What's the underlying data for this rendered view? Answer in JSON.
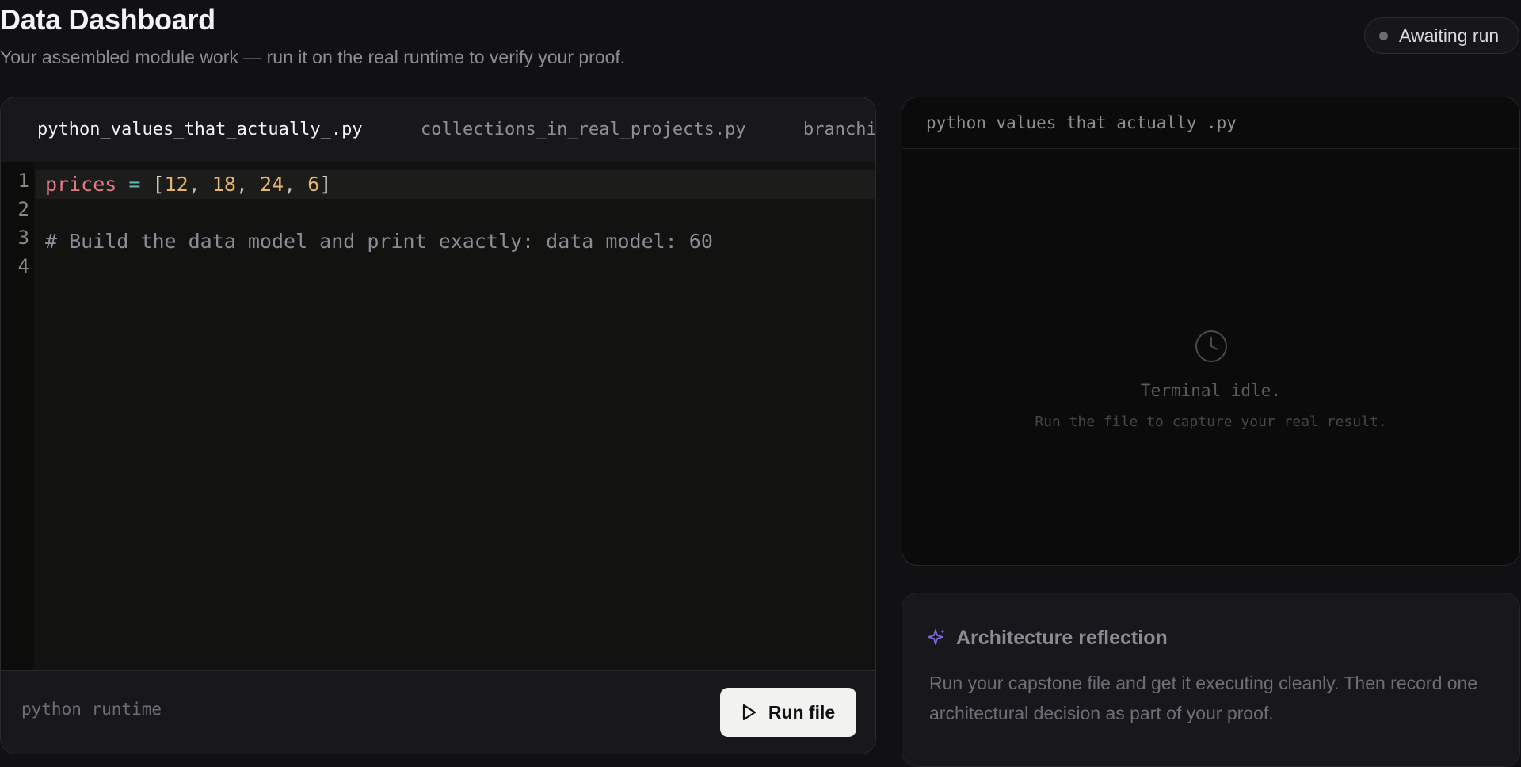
{
  "header": {
    "title": "Data Dashboard",
    "subtitle": "Your assembled module work — run it on the real runtime to verify your proof.",
    "status": "Awaiting run"
  },
  "editor": {
    "tabs": [
      {
        "label": "python_values_that_actually_.py",
        "active": true
      },
      {
        "label": "collections_in_real_projects.py",
        "active": false
      },
      {
        "label": "branchi",
        "active": false
      }
    ],
    "line_numbers": [
      "1",
      "2",
      "3",
      "4"
    ],
    "code": {
      "line1": {
        "var": "prices",
        "op": "=",
        "open": "[",
        "n1": "12",
        "n2": "18",
        "n3": "24",
        "n4": "6",
        "sep": ",",
        "close": "]"
      },
      "line3": "# Build the data model and print exactly: data model: 60"
    },
    "runtime_label": "python runtime",
    "run_button": "Run file"
  },
  "terminal": {
    "file_name": "python_values_that_actually_.py",
    "idle_text": "Terminal idle.",
    "hint_text": "Run the file to capture your real result.",
    "icon": "clock-icon"
  },
  "reflection": {
    "icon": "sparkle-icon",
    "title": "Architecture reflection",
    "body": "Run your capstone file and get it executing cleanly. Then record one architectural decision as part of your proof."
  },
  "colors": {
    "background": "#111114",
    "panel": "#18181c",
    "accent_sparkle": "#7c6bd6",
    "keyword_var": "#e27a83",
    "number": "#e6b673"
  }
}
